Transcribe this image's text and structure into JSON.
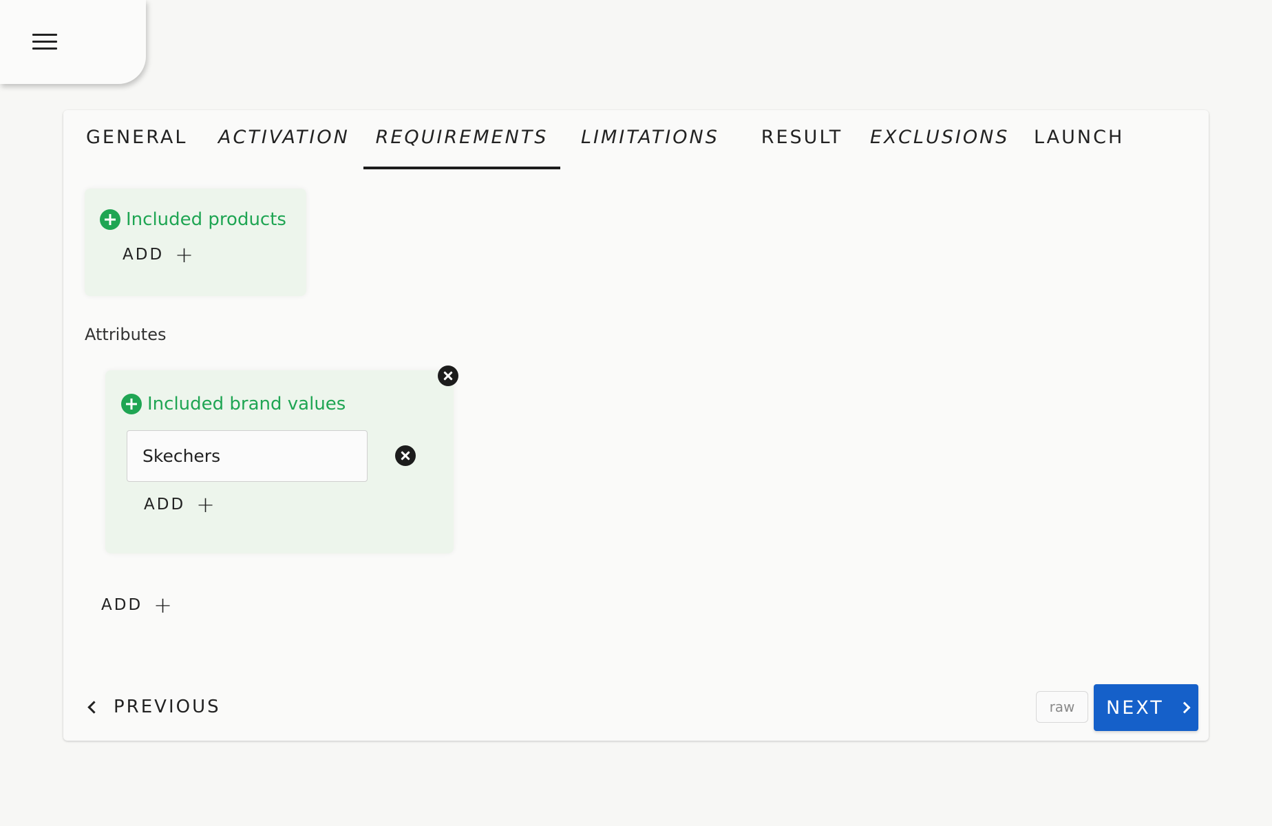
{
  "tabs": [
    {
      "label": "GENERAL",
      "italic": false,
      "active": false
    },
    {
      "label": "ACTIVATION",
      "italic": true,
      "active": false
    },
    {
      "label": "REQUIREMENTS",
      "italic": true,
      "active": true
    },
    {
      "label": "LIMITATIONS",
      "italic": true,
      "active": false
    },
    {
      "label": "RESULT",
      "italic": false,
      "active": false
    },
    {
      "label": "EXCLUSIONS",
      "italic": true,
      "active": false
    },
    {
      "label": "LAUNCH",
      "italic": false,
      "active": false
    }
  ],
  "products_group": {
    "title": "Included products",
    "add_label": "ADD",
    "add_symbol": "+"
  },
  "attributes": {
    "label": "Attributes",
    "brand_group": {
      "title": "Included brand values",
      "value": "Skechers",
      "add_label": "ADD",
      "add_symbol": "+"
    },
    "add_label": "ADD",
    "add_symbol": "+"
  },
  "footer": {
    "previous_label": "PREVIOUS",
    "raw_label": "raw",
    "next_label": "NEXT"
  },
  "colors": {
    "accent_green": "#1fa553",
    "primary_blue": "#1560c9",
    "group_background": "#edf5ec"
  },
  "icons": {
    "menu": "hamburger-icon",
    "add_group": "plus-circle-icon",
    "remove": "close-circle-icon",
    "previous": "chevron-left-icon",
    "next": "chevron-right-icon"
  }
}
